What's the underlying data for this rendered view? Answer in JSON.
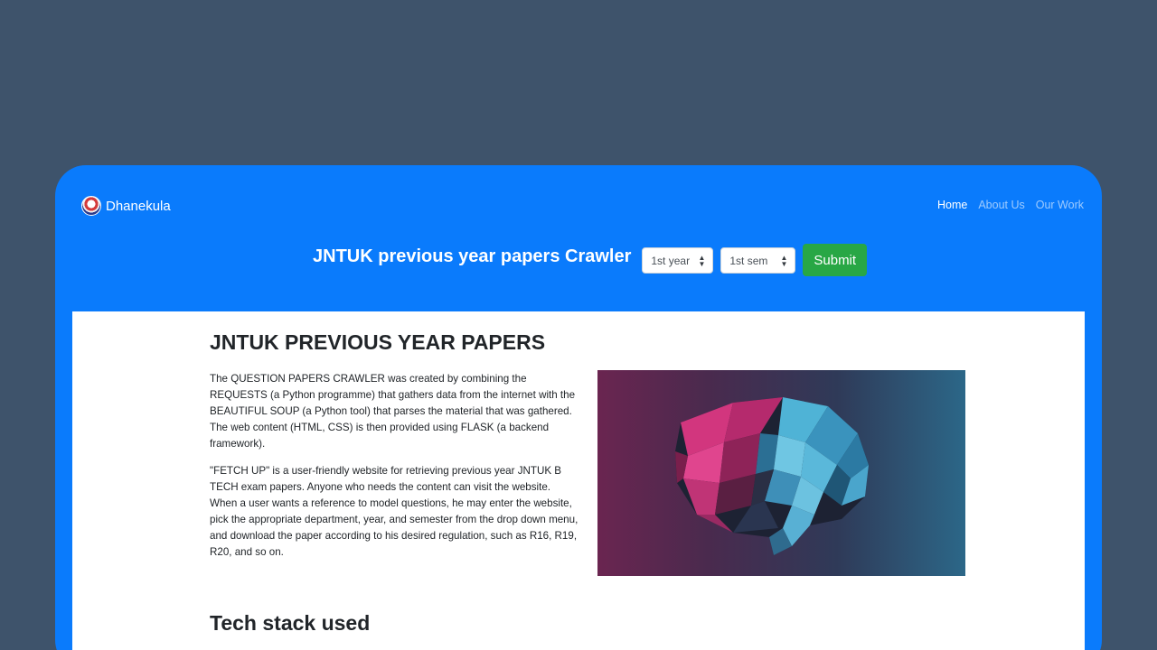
{
  "navbar": {
    "brand": "Dhanekula",
    "links": [
      "Home",
      "About Us",
      "Our Work"
    ]
  },
  "hero": {
    "title": "JNTUK previous year papers Crawler",
    "year_select": "1st year",
    "sem_select": "1st sem",
    "submit_label": "Submit"
  },
  "main": {
    "heading": "JNTUK PREVIOUS YEAR PAPERS",
    "para1": "The QUESTION PAPERS CRAWLER was created by combining the REQUESTS (a Python programme) that gathers data from the internet with the BEAUTIFUL SOUP (a Python tool) that parses the material that was gathered. The web content (HTML, CSS) is then provided using FLASK (a backend framework).",
    "para2": "\"FETCH UP\" is a user-friendly website for retrieving previous year JNTUK B TECH exam papers. Anyone who needs the content can visit the website. When a user wants a reference to model questions, he may enter the website, pick the appropriate department, year, and semester from the drop down menu, and download the paper according to his desired regulation, such as R16, R19, R20, and so on.",
    "tech_heading": "Tech stack used"
  },
  "colors": {
    "accent": "#0a7bfc",
    "submit": "#28a745",
    "backdrop": "#3e536b"
  },
  "icons": {
    "brand_logo": "college-logo-icon",
    "select_caret": "updown-caret-icon"
  }
}
